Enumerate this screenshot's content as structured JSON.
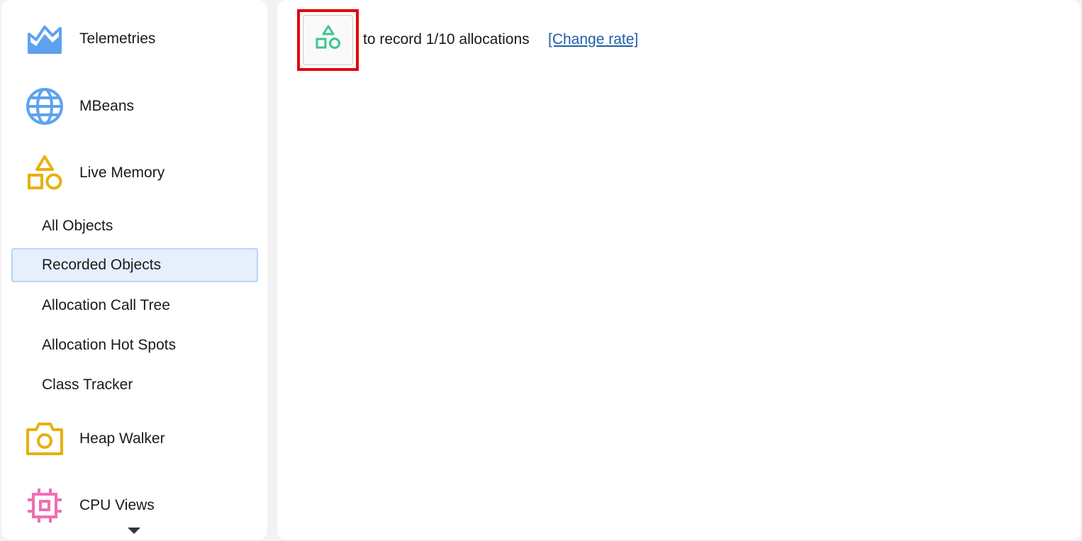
{
  "sidebar": {
    "sections": {
      "telemetries": {
        "label": "Telemetries",
        "icon": "telemetries-chart-icon",
        "color": "#5ea2ef"
      },
      "mbeans": {
        "label": "MBeans",
        "icon": "globe-icon",
        "color": "#5ea2ef"
      },
      "live_memory": {
        "label": "Live Memory",
        "icon": "shapes-icon",
        "color": "#e6b10e"
      },
      "heap_walker": {
        "label": "Heap Walker",
        "icon": "camera-icon",
        "color": "#e6b10e"
      },
      "cpu_views": {
        "label": "CPU Views",
        "icon": "cpu-chip-icon",
        "color": "#ee6fb3"
      }
    },
    "live_memory_items": [
      {
        "label": "All Objects",
        "selected": false
      },
      {
        "label": "Recorded Objects",
        "selected": true
      },
      {
        "label": "Allocation Call Tree",
        "selected": false
      },
      {
        "label": "Allocation Hot Spots",
        "selected": false
      },
      {
        "label": "Class Tracker",
        "selected": false
      }
    ],
    "scroll_indicator": "chevron-down-icon"
  },
  "main": {
    "record_button": {
      "icon": "shapes-icon",
      "color": "#3fc58a",
      "highlight_color": "#e60000"
    },
    "hint_text": "to record 1/10 allocations",
    "change_rate_link": "[Change rate]"
  }
}
